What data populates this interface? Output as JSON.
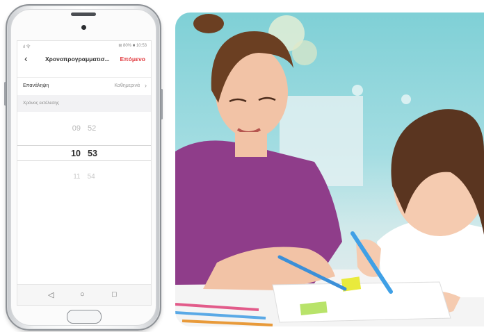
{
  "app": {
    "statusbar": {
      "left": "ıl 令",
      "right": "⊞ 80% ■ 10:53"
    },
    "nav": {
      "back_icon": "chevron-left-icon",
      "title": "Χρονοπρογραμματισ...",
      "next_label": "Επόμενο"
    },
    "repeat_row": {
      "label": "Επανάληψη",
      "value": "Καθημερινά",
      "chevron": "›"
    },
    "section_label": "Χρόνος εκτέλεσης",
    "time_picker": {
      "above": {
        "hour": "09",
        "minute": "52"
      },
      "selected": {
        "hour": "10",
        "minute": "53"
      },
      "below": {
        "hour": "11",
        "minute": "54"
      }
    },
    "system_nav": {
      "back": "◁",
      "home": "○",
      "recents": "□"
    }
  },
  "colors": {
    "accent": "#e0353a",
    "screen_bg": "#ffffff",
    "section_bg": "#f2f2f4",
    "photo_wall": "#8fd5da",
    "shirt": "#8f3d8a"
  },
  "photo": {
    "subject": "mother-and-child-drawing-scene"
  }
}
